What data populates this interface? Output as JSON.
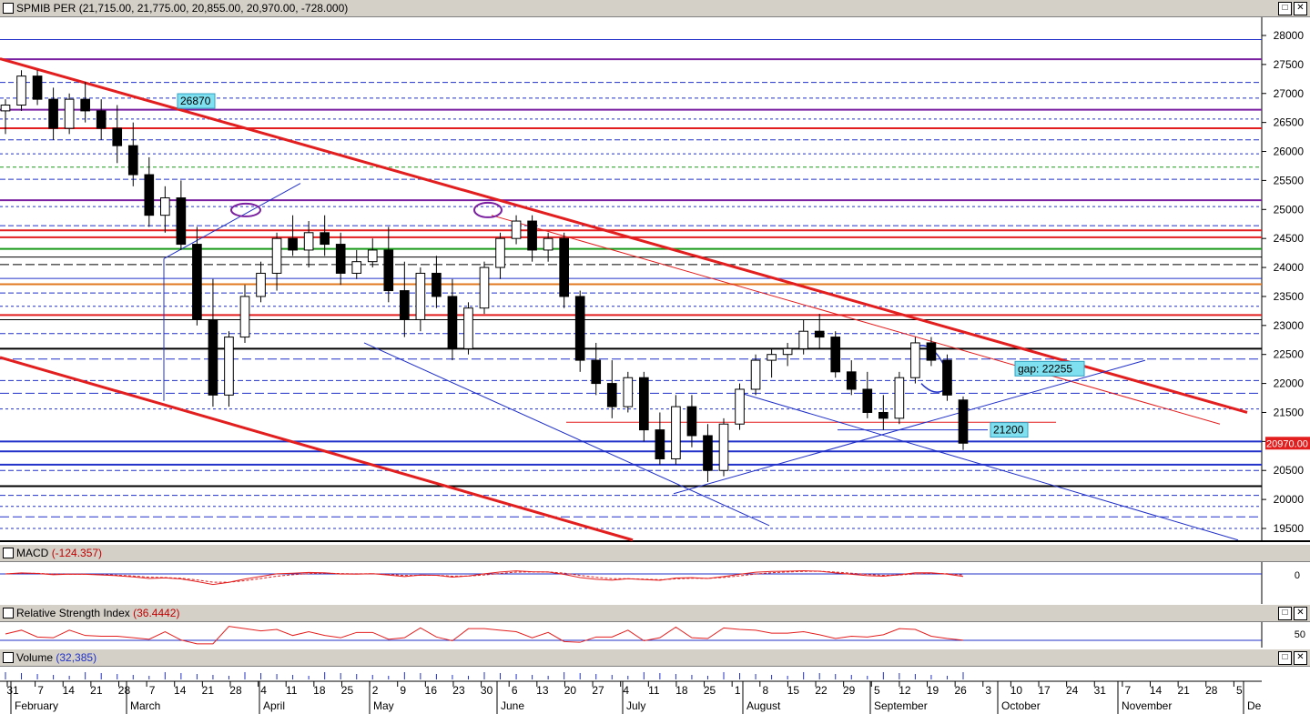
{
  "main": {
    "title": "SPMIB PER",
    "ohlc": "(21,715.00, 21,775.00, 20,855.00, 20,970.00, -728.000)",
    "price_tag": "20970.00",
    "annotations": [
      {
        "label": "26870"
      },
      {
        "label": "gap: 22255"
      },
      {
        "label": "21200"
      }
    ]
  },
  "macd": {
    "title": "MACD",
    "value": "(-124.357)",
    "tick": "0"
  },
  "rsi": {
    "title": "Relative Strength Index",
    "value": "(36.4442)",
    "tick": "50"
  },
  "volume": {
    "title": "Volume",
    "value": "(32,385)"
  },
  "colors": {
    "red": "#e31e1e",
    "blue": "#2030c8",
    "purple": "#7a1fa0",
    "green": "#1a9a1a",
    "orange": "#e07820",
    "bg": "#ffffff",
    "cyan_label": "#7fe0f0"
  },
  "chart_data": {
    "type": "candlestick",
    "ylim": [
      19300,
      28200
    ],
    "y_ticks": [
      28000,
      27500,
      27000,
      26500,
      26000,
      25500,
      25000,
      24500,
      24000,
      23500,
      23000,
      22500,
      22000,
      21500,
      21000,
      20500,
      20000,
      19500
    ],
    "x_day_labels": [
      "31",
      "7",
      "14",
      "21",
      "28",
      "7",
      "14",
      "21",
      "28",
      "4",
      "11",
      "18",
      "25",
      "2",
      "9",
      "16",
      "23",
      "30",
      "6",
      "13",
      "20",
      "27",
      "4",
      "11",
      "18",
      "25",
      "1",
      "8",
      "15",
      "22",
      "29",
      "5",
      "12",
      "19",
      "26",
      "3",
      "10",
      "17",
      "24",
      "31",
      "7",
      "14",
      "21",
      "28",
      "5"
    ],
    "x_month_labels": [
      "February",
      "March",
      "April",
      "May",
      "June",
      "July",
      "August",
      "September",
      "October",
      "November",
      "De"
    ],
    "candles": [
      [
        26700,
        26900,
        26300,
        26800
      ],
      [
        26800,
        27400,
        26700,
        27300
      ],
      [
        27300,
        27400,
        26800,
        26900
      ],
      [
        26900,
        27100,
        26200,
        26400
      ],
      [
        26400,
        27000,
        26300,
        26900
      ],
      [
        26900,
        27200,
        26500,
        26700
      ],
      [
        26700,
        26900,
        26200,
        26400
      ],
      [
        26400,
        26800,
        25800,
        26100
      ],
      [
        26100,
        26500,
        25400,
        25600
      ],
      [
        25600,
        25900,
        24700,
        24900
      ],
      [
        24900,
        25400,
        24600,
        25200
      ],
      [
        25200,
        25500,
        24300,
        24400
      ],
      [
        24400,
        24700,
        23000,
        23100
      ],
      [
        23100,
        23800,
        21600,
        21800
      ],
      [
        21800,
        22900,
        21600,
        22800
      ],
      [
        22800,
        23700,
        22700,
        23500
      ],
      [
        23500,
        24100,
        23400,
        23900
      ],
      [
        23900,
        24600,
        23600,
        24500
      ],
      [
        24500,
        24900,
        24200,
        24300
      ],
      [
        24300,
        24800,
        24000,
        24600
      ],
      [
        24600,
        24900,
        24200,
        24400
      ],
      [
        24400,
        24600,
        23700,
        23900
      ],
      [
        23900,
        24300,
        23800,
        24100
      ],
      [
        24100,
        24500,
        24000,
        24300
      ],
      [
        24300,
        24700,
        23400,
        23600
      ],
      [
        23600,
        24100,
        22800,
        23100
      ],
      [
        23100,
        24000,
        22900,
        23900
      ],
      [
        23900,
        24200,
        23300,
        23500
      ],
      [
        23500,
        23800,
        22400,
        22600
      ],
      [
        22600,
        23400,
        22500,
        23300
      ],
      [
        23300,
        24100,
        23200,
        24000
      ],
      [
        24000,
        24600,
        23800,
        24500
      ],
      [
        24500,
        24900,
        24400,
        24800
      ],
      [
        24800,
        24900,
        24100,
        24300
      ],
      [
        24300,
        24600,
        24100,
        24500
      ],
      [
        24500,
        24600,
        23300,
        23500
      ],
      [
        23500,
        23600,
        22200,
        22400
      ],
      [
        22400,
        22700,
        21800,
        22000
      ],
      [
        22000,
        22400,
        21400,
        21600
      ],
      [
        21600,
        22200,
        21500,
        22100
      ],
      [
        22100,
        22200,
        21000,
        21200
      ],
      [
        21200,
        21500,
        20600,
        20700
      ],
      [
        20700,
        21800,
        20600,
        21600
      ],
      [
        21600,
        21800,
        20900,
        21100
      ],
      [
        21100,
        21300,
        20300,
        20500
      ],
      [
        20500,
        21400,
        20400,
        21300
      ],
      [
        21300,
        22000,
        21200,
        21900
      ],
      [
        21900,
        22500,
        21800,
        22400
      ],
      [
        22400,
        22600,
        22100,
        22500
      ],
      [
        22500,
        22700,
        22300,
        22600
      ],
      [
        22600,
        23100,
        22500,
        22900
      ],
      [
        22900,
        23200,
        22600,
        22800
      ],
      [
        22800,
        22900,
        22100,
        22200
      ],
      [
        22200,
        22400,
        21800,
        21900
      ],
      [
        21900,
        22200,
        21400,
        21500
      ],
      [
        21500,
        21800,
        21200,
        21400
      ],
      [
        21400,
        22200,
        21300,
        22100
      ],
      [
        22100,
        22800,
        22000,
        22700
      ],
      [
        22700,
        22800,
        22300,
        22400
      ],
      [
        22400,
        22500,
        21700,
        21800
      ],
      [
        21715,
        21775,
        20855,
        20970
      ]
    ]
  }
}
